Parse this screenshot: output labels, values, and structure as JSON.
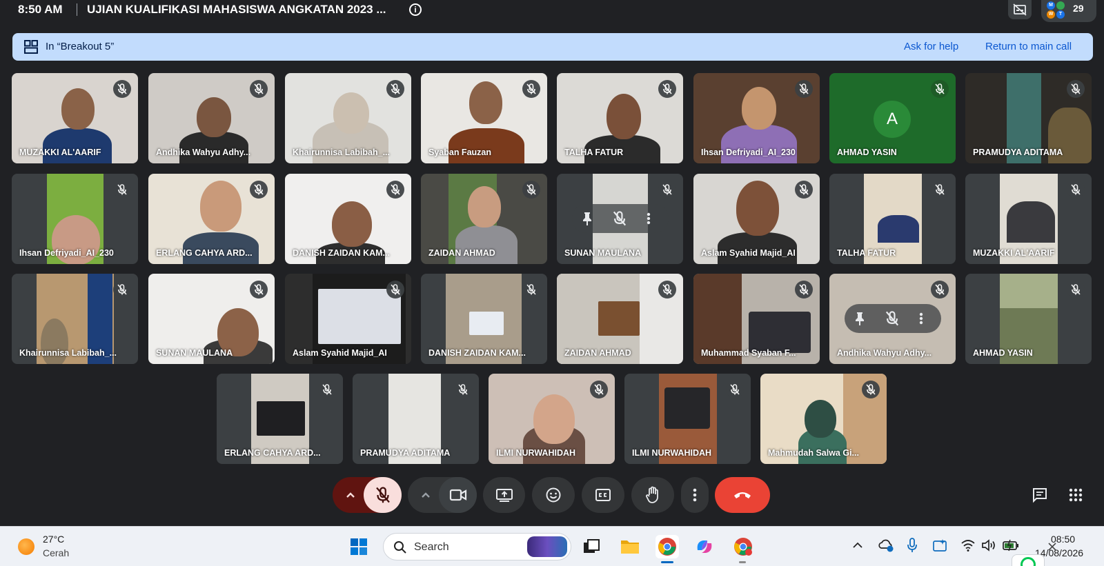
{
  "topbar": {
    "time": "8:50 AM",
    "meeting_title": "UJIAN KUALIFIKASI MAHASISWA ANGKATAN 2023 ...",
    "info_glyph": "i",
    "participants_count": "29",
    "avatar_letters": [
      "M",
      "W",
      "T"
    ]
  },
  "breakout": {
    "label": "In “Breakout 5”",
    "ask_help": "Ask for help",
    "return_main": "Return to main call"
  },
  "participants": [
    {
      "name": "MUZAKKI AL'AARIF"
    },
    {
      "name": "Andhika Wahyu Adhy..."
    },
    {
      "name": "Khairunnisa Labibah_..."
    },
    {
      "name": "Syaban Fauzan"
    },
    {
      "name": "TALHA FATUR"
    },
    {
      "name": "Ihsan Defriyadi_AI_230"
    },
    {
      "name": "AHMAD YASIN",
      "avatar_letter": "A"
    },
    {
      "name": "PRAMUDYA ADITAMA"
    },
    {
      "name": "Ihsan Defriyadi_AI_230"
    },
    {
      "name": "ERLANG CAHYA ARD..."
    },
    {
      "name": "DANISH ZAIDAN KAM..."
    },
    {
      "name": "ZAIDAN AHMAD"
    },
    {
      "name": "SUNAN MAULANA"
    },
    {
      "name": "Aslam Syahid Majid_AI"
    },
    {
      "name": "TALHA FATUR"
    },
    {
      "name": "MUZAKKI AL'AARIF"
    },
    {
      "name": "Khairunnisa Labibah_..."
    },
    {
      "name": "SUNAN MAULANA"
    },
    {
      "name": "Aslam Syahid Majid_AI"
    },
    {
      "name": "DANISH ZAIDAN KAM..."
    },
    {
      "name": "ZAIDAN AHMAD"
    },
    {
      "name": "Muhammad Syaban F..."
    },
    {
      "name": "Andhika Wahyu Adhy..."
    },
    {
      "name": "AHMAD YASIN"
    },
    {
      "name": "ERLANG CAHYA ARD..."
    },
    {
      "name": "PRAMUDYA ADITAMA"
    },
    {
      "name": "ILMI NURWAHIDAH"
    },
    {
      "name": "ILMI NURWAHIDAH"
    },
    {
      "name": "Mahmudah Salwa Gi..."
    }
  ],
  "taskbar": {
    "weather_temp": "27°C",
    "weather_desc": "Cerah",
    "search_label": "Search",
    "clock_time": "08:50",
    "clock_date": "14/08/2026"
  }
}
